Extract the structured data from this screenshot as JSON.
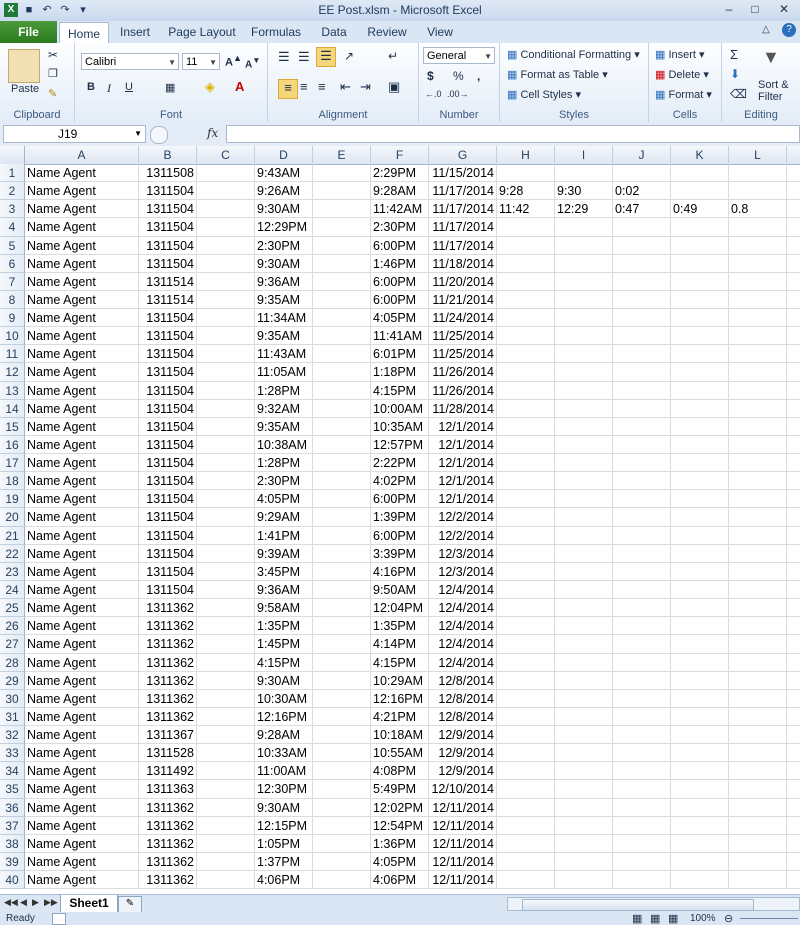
{
  "window": {
    "title": "EE Post.xlsm  -  Microsoft Excel"
  },
  "tabs": [
    "File",
    "Home",
    "Insert",
    "Page Layout",
    "Formulas",
    "Data",
    "Review",
    "View"
  ],
  "ribbon": {
    "clipboard": {
      "label": "Clipboard",
      "paste": "Paste"
    },
    "font": {
      "label": "Font",
      "name": "Calibri",
      "size": "11"
    },
    "alignment": {
      "label": "Alignment"
    },
    "number": {
      "label": "Number",
      "format": "General"
    },
    "styles": {
      "label": "Styles",
      "conditional": "Conditional Formatting",
      "format_table": "Format as Table",
      "cell_styles": "Cell Styles"
    },
    "cells": {
      "label": "Cells",
      "insert": "Insert",
      "delete": "Delete",
      "format": "Format"
    },
    "editing": {
      "label": "Editing",
      "sort_filter": "Sort & Filter"
    }
  },
  "formula_bar": {
    "name_box": "J19",
    "fx": "fx",
    "formula": ""
  },
  "columns": [
    "A",
    "B",
    "C",
    "D",
    "E",
    "F",
    "G",
    "H",
    "I",
    "J",
    "K",
    "L"
  ],
  "rows": [
    [
      "Name Agent",
      "1311508",
      "",
      "9:43AM",
      "",
      "2:29PM",
      "11/15/2014",
      "",
      "",
      "",
      "",
      ""
    ],
    [
      "Name Agent",
      "1311504",
      "",
      "9:26AM",
      "",
      "9:28AM",
      "11/17/2014",
      "9:28",
      "9:30",
      "0:02",
      "",
      ""
    ],
    [
      "Name Agent",
      "1311504",
      "",
      "9:30AM",
      "",
      "11:42AM",
      "11/17/2014",
      "11:42",
      "12:29",
      "0:47",
      "0:49",
      "0.8"
    ],
    [
      "Name Agent",
      "1311504",
      "",
      "12:29PM",
      "",
      "2:30PM",
      "11/17/2014",
      "",
      "",
      "",
      "",
      ""
    ],
    [
      "Name Agent",
      "1311504",
      "",
      "2:30PM",
      "",
      "6:00PM",
      "11/17/2014",
      "",
      "",
      "",
      "",
      ""
    ],
    [
      "Name Agent",
      "1311504",
      "",
      "9:30AM",
      "",
      "1:46PM",
      "11/18/2014",
      "",
      "",
      "",
      "",
      ""
    ],
    [
      "Name Agent",
      "1311514",
      "",
      "9:36AM",
      "",
      "6:00PM",
      "11/20/2014",
      "",
      "",
      "",
      "",
      ""
    ],
    [
      "Name Agent",
      "1311514",
      "",
      "9:35AM",
      "",
      "6:00PM",
      "11/21/2014",
      "",
      "",
      "",
      "",
      ""
    ],
    [
      "Name Agent",
      "1311504",
      "",
      "11:34AM",
      "",
      "4:05PM",
      "11/24/2014",
      "",
      "",
      "",
      "",
      ""
    ],
    [
      "Name Agent",
      "1311504",
      "",
      "9:35AM",
      "",
      "11:41AM",
      "11/25/2014",
      "",
      "",
      "",
      "",
      ""
    ],
    [
      "Name Agent",
      "1311504",
      "",
      "11:43AM",
      "",
      "6:01PM",
      "11/25/2014",
      "",
      "",
      "",
      "",
      ""
    ],
    [
      "Name Agent",
      "1311504",
      "",
      "11:05AM",
      "",
      "1:18PM",
      "11/26/2014",
      "",
      "",
      "",
      "",
      ""
    ],
    [
      "Name Agent",
      "1311504",
      "",
      "1:28PM",
      "",
      "4:15PM",
      "11/26/2014",
      "",
      "",
      "",
      "",
      ""
    ],
    [
      "Name Agent",
      "1311504",
      "",
      "9:32AM",
      "",
      "10:00AM",
      "11/28/2014",
      "",
      "",
      "",
      "",
      ""
    ],
    [
      "Name Agent",
      "1311504",
      "",
      "9:35AM",
      "",
      "10:35AM",
      "12/1/2014",
      "",
      "",
      "",
      "",
      ""
    ],
    [
      "Name Agent",
      "1311504",
      "",
      "10:38AM",
      "",
      "12:57PM",
      "12/1/2014",
      "",
      "",
      "",
      "",
      ""
    ],
    [
      "Name Agent",
      "1311504",
      "",
      "1:28PM",
      "",
      "2:22PM",
      "12/1/2014",
      "",
      "",
      "",
      "",
      ""
    ],
    [
      "Name Agent",
      "1311504",
      "",
      "2:30PM",
      "",
      "4:02PM",
      "12/1/2014",
      "",
      "",
      "",
      "",
      ""
    ],
    [
      "Name Agent",
      "1311504",
      "",
      "4:05PM",
      "",
      "6:00PM",
      "12/1/2014",
      "",
      "",
      "",
      "",
      ""
    ],
    [
      "Name Agent",
      "1311504",
      "",
      "9:29AM",
      "",
      "1:39PM",
      "12/2/2014",
      "",
      "",
      "",
      "",
      ""
    ],
    [
      "Name Agent",
      "1311504",
      "",
      "1:41PM",
      "",
      "6:00PM",
      "12/2/2014",
      "",
      "",
      "",
      "",
      ""
    ],
    [
      "Name Agent",
      "1311504",
      "",
      "9:39AM",
      "",
      "3:39PM",
      "12/3/2014",
      "",
      "",
      "",
      "",
      ""
    ],
    [
      "Name Agent",
      "1311504",
      "",
      "3:45PM",
      "",
      "4:16PM",
      "12/3/2014",
      "",
      "",
      "",
      "",
      ""
    ],
    [
      "Name Agent",
      "1311504",
      "",
      "9:36AM",
      "",
      "9:50AM",
      "12/4/2014",
      "",
      "",
      "",
      "",
      ""
    ],
    [
      "Name Agent",
      "1311362",
      "",
      "9:58AM",
      "",
      "12:04PM",
      "12/4/2014",
      "",
      "",
      "",
      "",
      ""
    ],
    [
      "Name Agent",
      "1311362",
      "",
      "1:35PM",
      "",
      "1:35PM",
      "12/4/2014",
      "",
      "",
      "",
      "",
      ""
    ],
    [
      "Name Agent",
      "1311362",
      "",
      "1:45PM",
      "",
      "4:14PM",
      "12/4/2014",
      "",
      "",
      "",
      "",
      ""
    ],
    [
      "Name Agent",
      "1311362",
      "",
      "4:15PM",
      "",
      "4:15PM",
      "12/4/2014",
      "",
      "",
      "",
      "",
      ""
    ],
    [
      "Name Agent",
      "1311362",
      "",
      "9:30AM",
      "",
      "10:29AM",
      "12/8/2014",
      "",
      "",
      "",
      "",
      ""
    ],
    [
      "Name Agent",
      "1311362",
      "",
      "10:30AM",
      "",
      "12:16PM",
      "12/8/2014",
      "",
      "",
      "",
      "",
      ""
    ],
    [
      "Name Agent",
      "1311362",
      "",
      "12:16PM",
      "",
      "4:21PM",
      "12/8/2014",
      "",
      "",
      "",
      "",
      ""
    ],
    [
      "Name Agent",
      "1311367",
      "",
      "9:28AM",
      "",
      "10:18AM",
      "12/9/2014",
      "",
      "",
      "",
      "",
      ""
    ],
    [
      "Name Agent",
      "1311528",
      "",
      "10:33AM",
      "",
      "10:55AM",
      "12/9/2014",
      "",
      "",
      "",
      "",
      ""
    ],
    [
      "Name Agent",
      "1311492",
      "",
      "11:00AM",
      "",
      "4:08PM",
      "12/9/2014",
      "",
      "",
      "",
      "",
      ""
    ],
    [
      "Name Agent",
      "1311363",
      "",
      "12:30PM",
      "",
      "5:49PM",
      "12/10/2014",
      "",
      "",
      "",
      "",
      ""
    ],
    [
      "Name Agent",
      "1311362",
      "",
      "9:30AM",
      "",
      "12:02PM",
      "12/11/2014",
      "",
      "",
      "",
      "",
      ""
    ],
    [
      "Name Agent",
      "1311362",
      "",
      "12:15PM",
      "",
      "12:54PM",
      "12/11/2014",
      "",
      "",
      "",
      "",
      ""
    ],
    [
      "Name Agent",
      "1311362",
      "",
      "1:05PM",
      "",
      "1:36PM",
      "12/11/2014",
      "",
      "",
      "",
      "",
      ""
    ],
    [
      "Name Agent",
      "1311362",
      "",
      "1:37PM",
      "",
      "4:05PM",
      "12/11/2014",
      "",
      "",
      "",
      "",
      ""
    ],
    [
      "Name Agent",
      "1311362",
      "",
      "4:06PM",
      "",
      "4:06PM",
      "12/11/2014",
      "",
      "",
      "",
      "",
      ""
    ]
  ],
  "sheets": {
    "active": "Sheet1"
  },
  "status": {
    "left": "Ready",
    "zoom": "100%"
  }
}
